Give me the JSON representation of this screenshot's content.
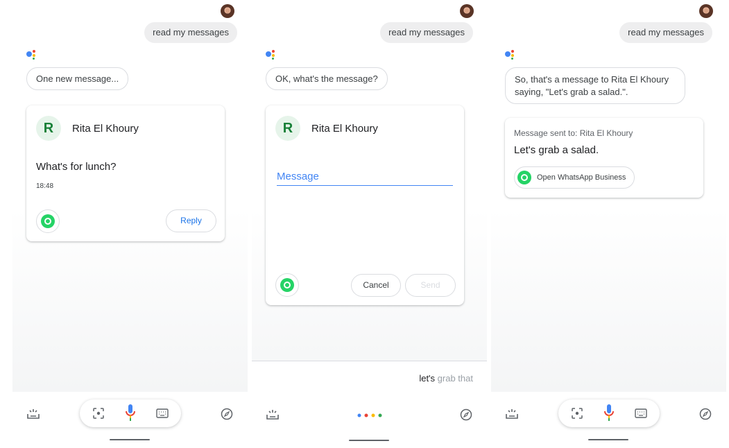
{
  "panel1": {
    "user_query": "read my messages",
    "assistant_reply": "One new message...",
    "card": {
      "contact_initial": "R",
      "contact_name": "Rita El Khoury",
      "message_text": "What's for lunch?",
      "time": "18:48",
      "reply_label": "Reply"
    }
  },
  "panel2": {
    "user_query": "read my messages",
    "assistant_reply": "OK, what's the message?",
    "card": {
      "contact_initial": "R",
      "contact_name": "Rita El Khoury",
      "message_placeholder": "Message",
      "cancel_label": "Cancel",
      "send_label": "Send"
    },
    "transcription": {
      "bold": "let's",
      "light": "grab that"
    }
  },
  "panel3": {
    "user_query": "read my messages",
    "assistant_reply": "So, that's a message to Rita El Khoury saying, \"Let's grab a salad.\".",
    "card": {
      "sent_to": "Message sent to: Rita El Khoury",
      "message_text": "Let's grab a salad.",
      "open_app_label": "Open WhatsApp Business"
    }
  },
  "colors": {
    "accent_blue": "#4285f4",
    "whatsapp_green": "#25d366",
    "contact_circle_bg": "#e6f4ea",
    "contact_initial": "#188038",
    "bubble_gray": "#eeeeef"
  },
  "icons": {
    "updates": "snapshot-tray-icon",
    "lens": "lens-icon",
    "mic": "mic-icon",
    "keyboard": "keyboard-icon",
    "explore": "compass-icon",
    "whatsapp": "whatsapp-icon"
  }
}
